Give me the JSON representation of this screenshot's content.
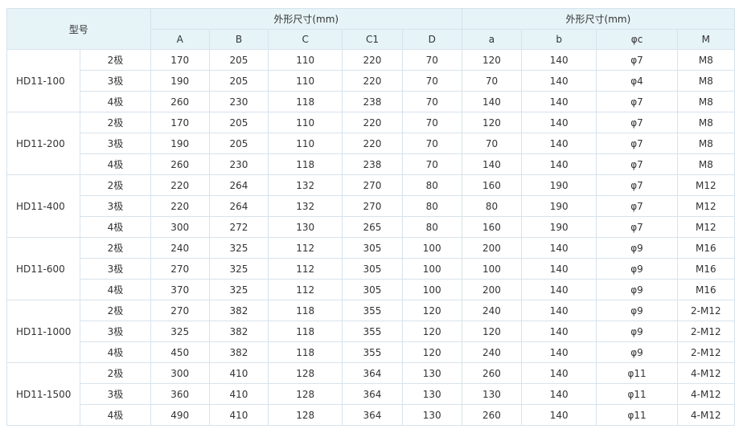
{
  "table": {
    "model_header": "型号",
    "group_headers": [
      "外形尺寸(mm)",
      "外形尺寸(mm)"
    ],
    "columns": [
      "A",
      "B",
      "C",
      "C1",
      "D",
      "a",
      "b",
      "φc",
      "M"
    ],
    "groups": [
      {
        "model": "HD11-100",
        "rows": [
          {
            "pole": "2极",
            "values": [
              "170",
              "205",
              "110",
              "220",
              "70",
              "120",
              "140",
              "φ7",
              "M8"
            ]
          },
          {
            "pole": "3极",
            "values": [
              "190",
              "205",
              "110",
              "220",
              "70",
              "70",
              "140",
              "φ4",
              "M8"
            ]
          },
          {
            "pole": "4极",
            "values": [
              "260",
              "230",
              "118",
              "238",
              "70",
              "140",
              "140",
              "φ7",
              "M8"
            ]
          }
        ]
      },
      {
        "model": "HD11-200",
        "rows": [
          {
            "pole": "2极",
            "values": [
              "170",
              "205",
              "110",
              "220",
              "70",
              "120",
              "140",
              "φ7",
              "M8"
            ]
          },
          {
            "pole": "3极",
            "values": [
              "190",
              "205",
              "110",
              "220",
              "70",
              "70",
              "140",
              "φ7",
              "M8"
            ]
          },
          {
            "pole": "4极",
            "values": [
              "260",
              "230",
              "118",
              "238",
              "70",
              "140",
              "140",
              "φ7",
              "M8"
            ]
          }
        ]
      },
      {
        "model": "HD11-400",
        "rows": [
          {
            "pole": "2极",
            "values": [
              "220",
              "264",
              "132",
              "270",
              "80",
              "160",
              "190",
              "φ7",
              "M12"
            ]
          },
          {
            "pole": "3极",
            "values": [
              "220",
              "264",
              "132",
              "270",
              "80",
              "80",
              "190",
              "φ7",
              "M12"
            ]
          },
          {
            "pole": "4极",
            "values": [
              "300",
              "272",
              "130",
              "265",
              "80",
              "160",
              "190",
              "φ7",
              "M12"
            ]
          }
        ]
      },
      {
        "model": "HD11-600",
        "rows": [
          {
            "pole": "2极",
            "values": [
              "240",
              "325",
              "112",
              "305",
              "100",
              "200",
              "140",
              "φ9",
              "M16"
            ]
          },
          {
            "pole": "3极",
            "values": [
              "270",
              "325",
              "112",
              "305",
              "100",
              "100",
              "140",
              "φ9",
              "M16"
            ]
          },
          {
            "pole": "4极",
            "values": [
              "370",
              "325",
              "112",
              "305",
              "100",
              "200",
              "140",
              "φ9",
              "M16"
            ]
          }
        ]
      },
      {
        "model": "HD11-1000",
        "rows": [
          {
            "pole": "2极",
            "values": [
              "270",
              "382",
              "118",
              "355",
              "120",
              "240",
              "140",
              "φ9",
              "2-M12"
            ]
          },
          {
            "pole": "3极",
            "values": [
              "325",
              "382",
              "118",
              "355",
              "120",
              "120",
              "140",
              "φ9",
              "2-M12"
            ]
          },
          {
            "pole": "4极",
            "values": [
              "450",
              "382",
              "118",
              "355",
              "120",
              "240",
              "140",
              "φ9",
              "2-M12"
            ]
          }
        ]
      },
      {
        "model": "HD11-1500",
        "rows": [
          {
            "pole": "2极",
            "values": [
              "300",
              "410",
              "128",
              "364",
              "130",
              "260",
              "140",
              "φ11",
              "4-M12"
            ]
          },
          {
            "pole": "3极",
            "values": [
              "360",
              "410",
              "128",
              "364",
              "130",
              "130",
              "140",
              "φ11",
              "4-M12"
            ]
          },
          {
            "pole": "4极",
            "values": [
              "490",
              "410",
              "128",
              "364",
              "130",
              "260",
              "140",
              "φ11",
              "4-M12"
            ]
          }
        ]
      }
    ]
  }
}
